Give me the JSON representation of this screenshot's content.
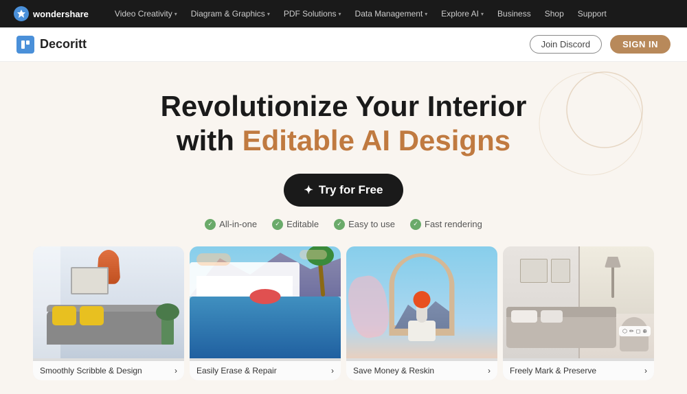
{
  "topNav": {
    "brand": "wondershare",
    "links": [
      {
        "label": "Video Creativity",
        "hasDropdown": true
      },
      {
        "label": "Diagram & Graphics",
        "hasDropdown": true
      },
      {
        "label": "PDF Solutions",
        "hasDropdown": true
      },
      {
        "label": "Data Management",
        "hasDropdown": true
      },
      {
        "label": "Explore AI",
        "hasDropdown": true
      },
      {
        "label": "Business",
        "hasDropdown": false
      },
      {
        "label": "Shop",
        "hasDropdown": false
      },
      {
        "label": "Support",
        "hasDropdown": false
      }
    ]
  },
  "secondaryNav": {
    "brandName": "Decoritt",
    "joinDiscordLabel": "Join Discord",
    "signInLabel": "SIGN IN"
  },
  "hero": {
    "titleLine1": "Revolutionize Your Interior",
    "titleLine2Pre": "with ",
    "titleLine2Accent": "Editable AI Designs",
    "ctaLabel": "Try for Free",
    "features": [
      {
        "label": "All-in-one"
      },
      {
        "label": "Editable"
      },
      {
        "label": "Easy to use"
      },
      {
        "label": "Fast rendering"
      }
    ]
  },
  "cards": [
    {
      "id": "card-1",
      "label": "Smoothly Scribble & Design",
      "hasArrow": true
    },
    {
      "id": "card-2",
      "label": "Easily Erase & Repair",
      "hasArrow": true
    },
    {
      "id": "card-3",
      "label": "Save Money & Reskin",
      "hasArrow": true
    },
    {
      "id": "card-4",
      "label": "Freely Mark & Preserve",
      "hasArrow": true
    }
  ],
  "accentColor": "#c07a40",
  "brandColor": "#4a90d9"
}
